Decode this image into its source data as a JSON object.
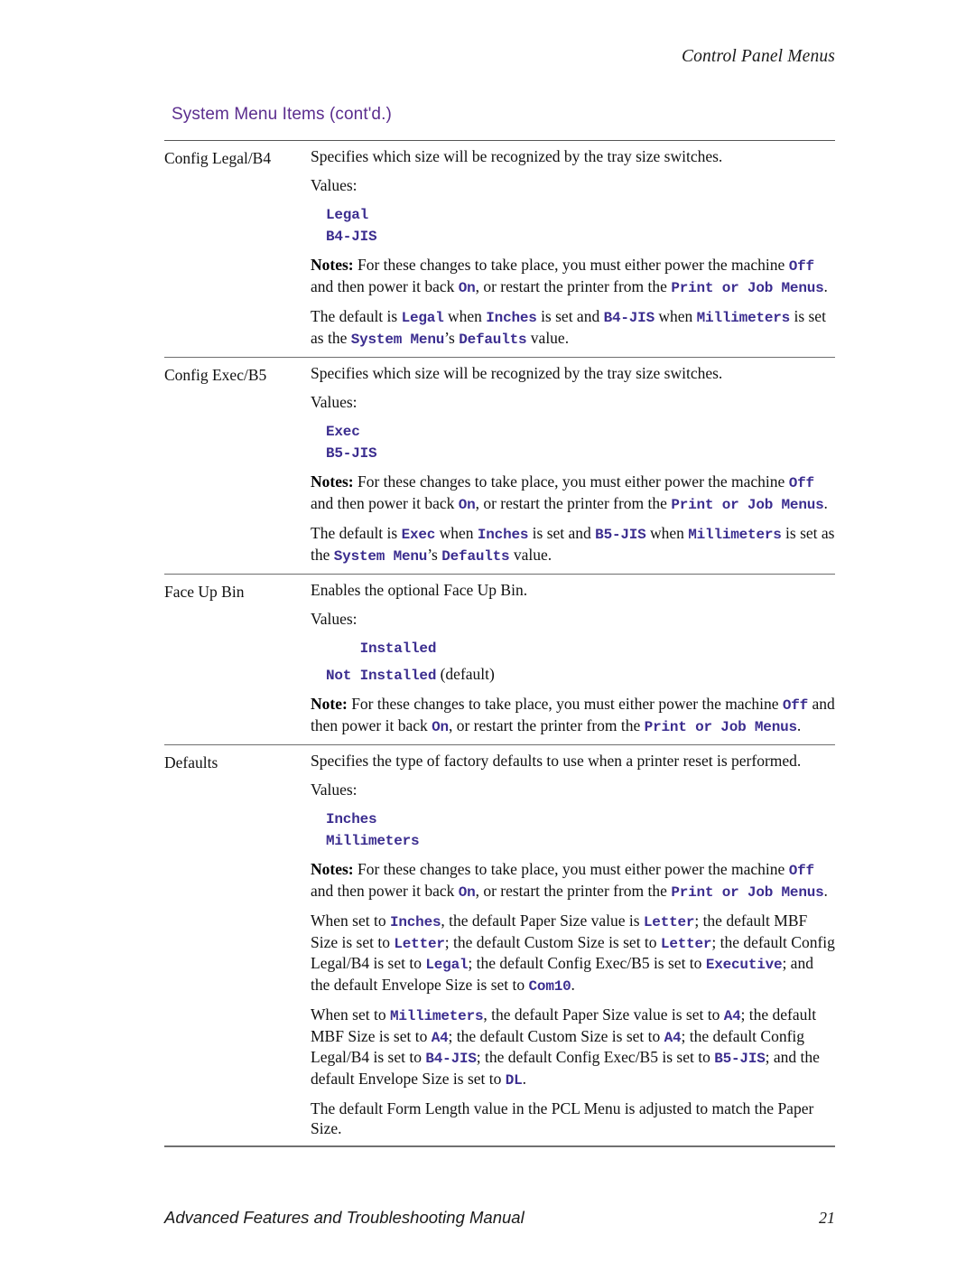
{
  "header": {
    "running_title": "Control Panel Menus"
  },
  "section": {
    "heading": "System Menu Items (cont'd.)"
  },
  "footer": {
    "manual_title": "Advanced Features and Troubleshooting Manual",
    "page_number": "21"
  },
  "table": {
    "rows": [
      {
        "label": "Config Legal/B4",
        "blocks": [
          {
            "type": "para",
            "runs": [
              {
                "style": "plain",
                "text": "Specifies which size will be recognized by the tray size switches."
              }
            ]
          },
          {
            "type": "para",
            "runs": [
              {
                "style": "plain",
                "text": "Values:"
              }
            ]
          },
          {
            "type": "values",
            "items": [
              [
                {
                  "style": "mono",
                  "text": "Legal"
                }
              ],
              [
                {
                  "style": "mono",
                  "text": "B4-JIS"
                }
              ]
            ]
          },
          {
            "type": "para",
            "runs": [
              {
                "style": "bold",
                "text": "Notes:"
              },
              {
                "style": "plain",
                "text": " For these changes to take place, you must either power the machine "
              },
              {
                "style": "mono",
                "text": "Off"
              },
              {
                "style": "plain",
                "text": "  and then power it back "
              },
              {
                "style": "mono",
                "text": "On"
              },
              {
                "style": "plain",
                "text": ", or restart the printer from the "
              },
              {
                "style": "mono",
                "text": "Print or Job Menus"
              },
              {
                "style": "plain",
                "text": "."
              }
            ]
          },
          {
            "type": "para",
            "runs": [
              {
                "style": "plain",
                "text": "The default is "
              },
              {
                "style": "mono",
                "text": "Legal"
              },
              {
                "style": "plain",
                "text": " when "
              },
              {
                "style": "mono",
                "text": "Inches"
              },
              {
                "style": "plain",
                "text": " is set and "
              },
              {
                "style": "mono",
                "text": "B4-JIS"
              },
              {
                "style": "plain",
                "text": " when "
              },
              {
                "style": "mono",
                "text": "Millimeters"
              },
              {
                "style": "plain",
                "text": " is set as the "
              },
              {
                "style": "mono",
                "text": "System Menu"
              },
              {
                "style": "plain",
                "text": "’s "
              },
              {
                "style": "mono",
                "text": "Defaults"
              },
              {
                "style": "plain",
                "text": " value."
              }
            ]
          }
        ]
      },
      {
        "label": "Config Exec/B5",
        "blocks": [
          {
            "type": "para",
            "runs": [
              {
                "style": "plain",
                "text": "Specifies which size will be recognized by the tray size switches."
              }
            ]
          },
          {
            "type": "para",
            "runs": [
              {
                "style": "plain",
                "text": "Values:"
              }
            ]
          },
          {
            "type": "values",
            "items": [
              [
                {
                  "style": "mono",
                  "text": "Exec"
                }
              ],
              [
                {
                  "style": "mono",
                  "text": "B5-JIS"
                }
              ]
            ]
          },
          {
            "type": "para",
            "runs": [
              {
                "style": "bold",
                "text": "Notes:"
              },
              {
                "style": "plain",
                "text": " For these changes to take place, you must either power the machine "
              },
              {
                "style": "mono",
                "text": "Off"
              },
              {
                "style": "plain",
                "text": "  and then power it back "
              },
              {
                "style": "mono",
                "text": "On"
              },
              {
                "style": "plain",
                "text": ", or restart the printer from the "
              },
              {
                "style": "mono",
                "text": "Print or Job Menus"
              },
              {
                "style": "plain",
                "text": "."
              }
            ]
          },
          {
            "type": "para",
            "runs": [
              {
                "style": "plain",
                "text": "The default is "
              },
              {
                "style": "mono",
                "text": "Exec"
              },
              {
                "style": "plain",
                "text": " when "
              },
              {
                "style": "mono",
                "text": "Inches"
              },
              {
                "style": "plain",
                "text": " is set and "
              },
              {
                "style": "mono",
                "text": "B5-JIS"
              },
              {
                "style": "plain",
                "text": " when "
              },
              {
                "style": "mono",
                "text": "Millimeters"
              },
              {
                "style": "plain",
                "text": " is set as the "
              },
              {
                "style": "mono",
                "text": "System Menu"
              },
              {
                "style": "plain",
                "text": "’s "
              },
              {
                "style": "mono",
                "text": "Defaults"
              },
              {
                "style": "plain",
                "text": " value."
              }
            ]
          }
        ]
      },
      {
        "label": "Face Up Bin",
        "blocks": [
          {
            "type": "para",
            "runs": [
              {
                "style": "plain",
                "text": "Enables the optional Face Up Bin."
              }
            ]
          },
          {
            "type": "para",
            "runs": [
              {
                "style": "plain",
                "text": "Values:"
              }
            ]
          },
          {
            "type": "values",
            "spaced": true,
            "items": [
              [
                {
                  "style": "mono",
                  "text": "    Installed"
                }
              ],
              [
                {
                  "style": "mono",
                  "text": "Not Installed"
                },
                {
                  "style": "plain",
                  "text": " (default)"
                }
              ]
            ]
          },
          {
            "type": "para",
            "runs": [
              {
                "style": "bold",
                "text": "Note:"
              },
              {
                "style": "plain",
                "text": " For these changes to take place, you must either power the machine "
              },
              {
                "style": "mono",
                "text": "Off"
              },
              {
                "style": "plain",
                "text": "  and then power it back "
              },
              {
                "style": "mono",
                "text": "On"
              },
              {
                "style": "plain",
                "text": ", or restart the printer from the "
              },
              {
                "style": "mono",
                "text": "Print or Job Menus"
              },
              {
                "style": "plain",
                "text": "."
              }
            ]
          }
        ]
      },
      {
        "label": "Defaults",
        "blocks": [
          {
            "type": "para",
            "runs": [
              {
                "style": "plain",
                "text": "Specifies the type of factory defaults to use when a printer reset is performed."
              }
            ]
          },
          {
            "type": "para",
            "runs": [
              {
                "style": "plain",
                "text": "Values:"
              }
            ]
          },
          {
            "type": "values",
            "items": [
              [
                {
                  "style": "mono",
                  "text": "Inches"
                }
              ],
              [
                {
                  "style": "mono",
                  "text": "Millimeters"
                }
              ]
            ]
          },
          {
            "type": "para",
            "runs": [
              {
                "style": "bold",
                "text": "Notes:"
              },
              {
                "style": "plain",
                "text": " For these changes to take place, you must either power the machine "
              },
              {
                "style": "mono",
                "text": "Off"
              },
              {
                "style": "plain",
                "text": "  and then power it back "
              },
              {
                "style": "mono",
                "text": "On"
              },
              {
                "style": "plain",
                "text": ", or restart the printer from the "
              },
              {
                "style": "mono",
                "text": "Print or Job Menus"
              },
              {
                "style": "plain",
                "text": "."
              }
            ]
          },
          {
            "type": "para",
            "runs": [
              {
                "style": "plain",
                "text": "When set to "
              },
              {
                "style": "mono",
                "text": "Inches"
              },
              {
                "style": "plain",
                "text": ", the default Paper Size value is "
              },
              {
                "style": "mono",
                "text": "Letter"
              },
              {
                "style": "plain",
                "text": "; the default MBF Size is set to "
              },
              {
                "style": "mono",
                "text": "Letter"
              },
              {
                "style": "plain",
                "text": "; the default Custom Size is set to "
              },
              {
                "style": "mono",
                "text": "Letter"
              },
              {
                "style": "plain",
                "text": "; the default Config Legal/B4 is set to "
              },
              {
                "style": "mono",
                "text": "Legal"
              },
              {
                "style": "plain",
                "text": "; the default Config Exec/B5 is set to "
              },
              {
                "style": "mono",
                "text": "Executive"
              },
              {
                "style": "plain",
                "text": "; and the default Envelope Size is set to "
              },
              {
                "style": "mono",
                "text": "Com10"
              },
              {
                "style": "plain",
                "text": "."
              }
            ]
          },
          {
            "type": "para",
            "runs": [
              {
                "style": "plain",
                "text": "When set to "
              },
              {
                "style": "mono",
                "text": "Millimeters"
              },
              {
                "style": "plain",
                "text": ", the default Paper Size value is set to "
              },
              {
                "style": "mono",
                "text": "A4"
              },
              {
                "style": "plain",
                "text": "; the default MBF Size is set to "
              },
              {
                "style": "mono",
                "text": "A4"
              },
              {
                "style": "plain",
                "text": "; the default Custom Size is set to "
              },
              {
                "style": "mono",
                "text": "A4"
              },
              {
                "style": "plain",
                "text": "; the default Config Legal/B4 is set to "
              },
              {
                "style": "mono",
                "text": "B4-JIS"
              },
              {
                "style": "plain",
                "text": "; the default Config Exec/B5 is set to "
              },
              {
                "style": "mono",
                "text": "B5-JIS"
              },
              {
                "style": "plain",
                "text": "; and the default Envelope Size is set to "
              },
              {
                "style": "mono",
                "text": "DL"
              },
              {
                "style": "plain",
                "text": "."
              }
            ]
          },
          {
            "type": "para",
            "runs": [
              {
                "style": "plain",
                "text": "The default Form Length value in the PCL Menu is adjusted to match the Paper Size."
              }
            ]
          }
        ]
      }
    ]
  }
}
